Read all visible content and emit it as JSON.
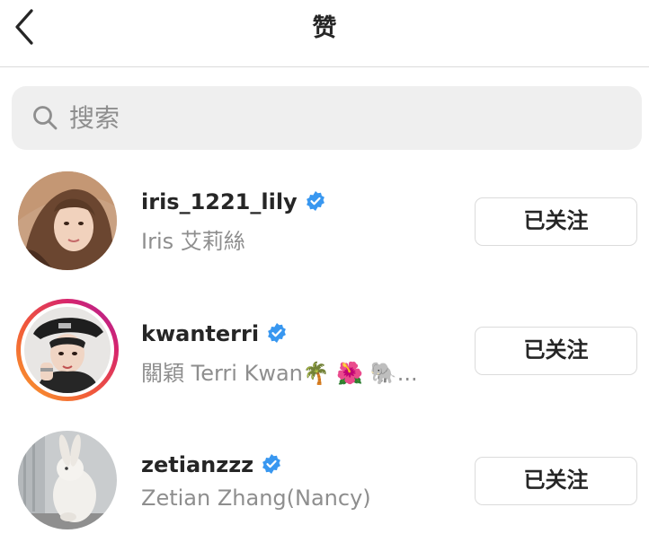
{
  "header": {
    "title": "赞",
    "back_icon": "chevron-left-icon"
  },
  "search": {
    "placeholder": "搜索",
    "value": "",
    "icon": "search-icon"
  },
  "users": [
    {
      "username": "iris_1221_lily",
      "verified": true,
      "full_name": "Iris 艾莉絲",
      "button_label": "已关注",
      "has_story": false
    },
    {
      "username": "kwanterri",
      "verified": true,
      "full_name": "關穎 Terri Kwan🌴 🌺 🐘...",
      "button_label": "已关注",
      "has_story": true
    },
    {
      "username": "zetianzzz",
      "verified": true,
      "full_name": "Zetian Zhang(Nancy)",
      "button_label": "已关注",
      "has_story": false
    }
  ],
  "colors": {
    "verified_badge": "#3897f0",
    "search_bg": "#efefef",
    "border": "#dbdbdb",
    "secondary_text": "#8e8e8e",
    "story_ring": [
      "#f9a02a",
      "#f15a39",
      "#d6246e",
      "#a322a0"
    ]
  }
}
